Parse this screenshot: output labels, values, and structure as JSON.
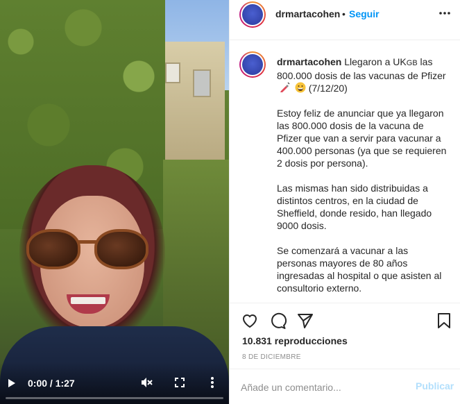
{
  "video": {
    "time": "0:00 / 1:27",
    "progress": 0.0,
    "controls": [
      "play-icon",
      "mute-icon",
      "fullscreen-icon",
      "more-vertical-icon"
    ]
  },
  "post": {
    "username": "drmartacohen",
    "dot": "•",
    "follow_label": "Seguir",
    "caption": {
      "line1": "Llegaron a UK",
      "flag_text": "GB",
      "line1_rest": " las 800.000 dosis de las vacunas de Pfizer",
      "date_text": " (7/12/20)",
      "paragraphs": [
        "Estoy feliz de anunciar que ya llegaron las 800.000 dosis de la vacuna de Pfizer que van a servir para vacunar a 400.000 personas (ya que se requieren 2 dosis por persona).",
        "Las mismas han sido distribuidas a distintos centros, en la ciudad de Sheffield, donde resido, han llegado 9000 dosis.",
        "Se comenzará a vacunar a las personas mayores de 80 años ingresadas al hospital o que asisten al consultorio externo."
      ],
      "emojis": [
        "syringe-icon",
        "grinning-face-icon"
      ]
    },
    "views": "10.831 reproducciones",
    "date": "8 DE DICIEMBRE",
    "comment_placeholder": "Añade un comentario...",
    "publish_label": "Publicar"
  },
  "colors": {
    "accent": "#0095f6",
    "publish_disabled": "#b2dffc",
    "muted": "#8e8e8e",
    "text": "#262626"
  }
}
